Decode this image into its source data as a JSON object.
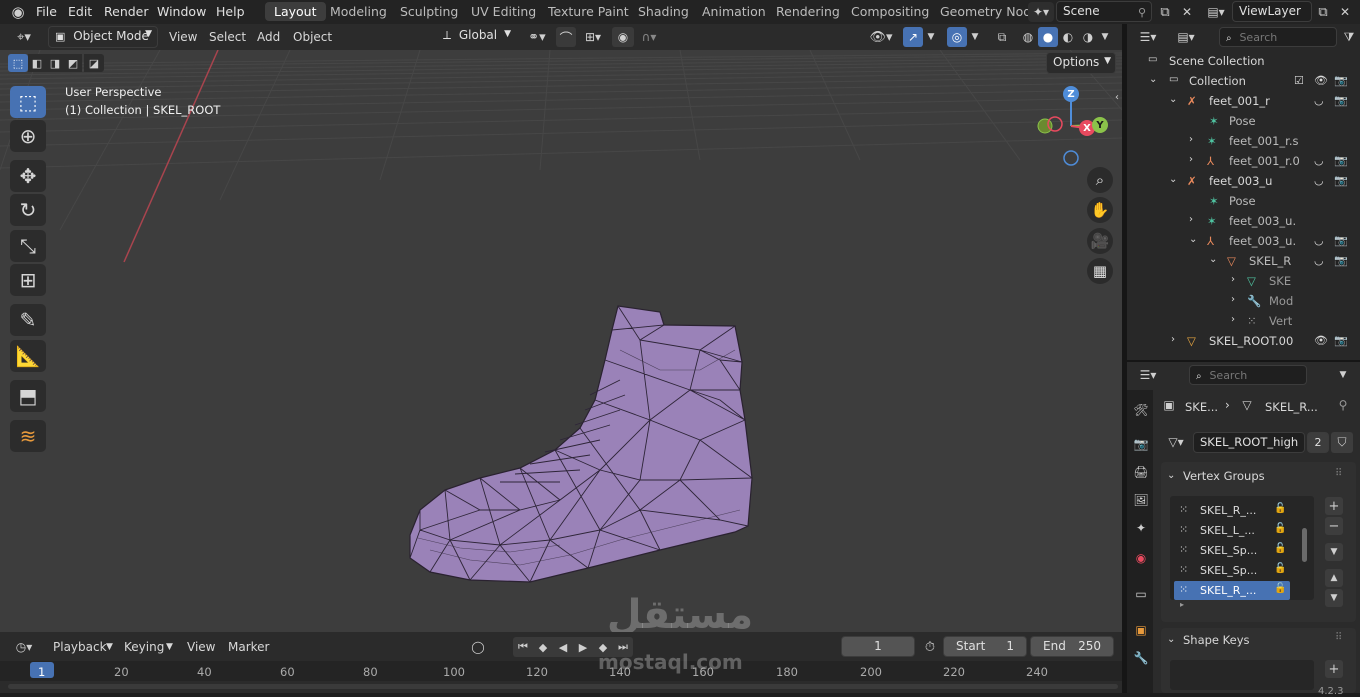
{
  "menu": [
    "File",
    "Edit",
    "Render",
    "Window",
    "Help"
  ],
  "workspaces": [
    "Layout",
    "Modeling",
    "Sculpting",
    "UV Editing",
    "Texture Paint",
    "Shading",
    "Animation",
    "Rendering",
    "Compositing",
    "Geometry Nod"
  ],
  "scene": {
    "name": "Scene",
    "view_layer": "ViewLayer"
  },
  "header3d": {
    "mode": "Object Mode",
    "menus": [
      "View",
      "Select",
      "Add",
      "Object"
    ],
    "orientation": "Global",
    "options_label": "Options"
  },
  "viewport": {
    "perspective": "User Perspective",
    "collection_info": "(1) Collection | SKEL_ROOT",
    "gizmo": {
      "z": "Z",
      "x": "X",
      "y": "Y"
    }
  },
  "outliner": {
    "search_placeholder": "Search",
    "rows": [
      {
        "label": "Scene Collection"
      },
      {
        "label": "Collection"
      },
      {
        "label": "feet_001_r"
      },
      {
        "label": "Pose"
      },
      {
        "label": "feet_001_r.s"
      },
      {
        "label": "feet_001_r.0"
      },
      {
        "label": "feet_003_u"
      },
      {
        "label": "Pose"
      },
      {
        "label": "feet_003_u."
      },
      {
        "label": "feet_003_u."
      },
      {
        "label": "SKEL_R"
      },
      {
        "label": "SKE"
      },
      {
        "label": "Mod"
      },
      {
        "label": "Vert"
      },
      {
        "label": "SKEL_ROOT.00"
      }
    ]
  },
  "properties": {
    "search_placeholder": "Search",
    "breadcrumb": [
      "SKE...",
      "SKEL_R..."
    ],
    "mesh_name": "SKEL_ROOT_high",
    "users": "2",
    "vertex_groups_title": "Vertex Groups",
    "vertex_groups": [
      "SKEL_R_...",
      "SKEL_L_...",
      "SKEL_Sp...",
      "SKEL_Sp...",
      "SKEL_R_..."
    ],
    "shape_keys_title": "Shape Keys"
  },
  "timeline": {
    "menus": [
      "Playback",
      "Keying",
      "View",
      "Marker"
    ],
    "current_frame": "1",
    "start_label": "Start",
    "start": "1",
    "end_label": "End",
    "end": "250",
    "ruler": [
      "1",
      "20",
      "40",
      "60",
      "80",
      "100",
      "120",
      "140",
      "160",
      "180",
      "200",
      "220",
      "240"
    ],
    "version": "4.2.3"
  },
  "watermark": {
    "arabic": "مستقل",
    "latin": "mostaql.com"
  },
  "colors": {
    "accent": "#4772b3",
    "mesh": "#9a82b8",
    "viewport_bg": "#3d3d3d",
    "axis_x": "#e84a5f",
    "axis_y": "#8bc34a",
    "axis_z": "#4f8dd9"
  }
}
